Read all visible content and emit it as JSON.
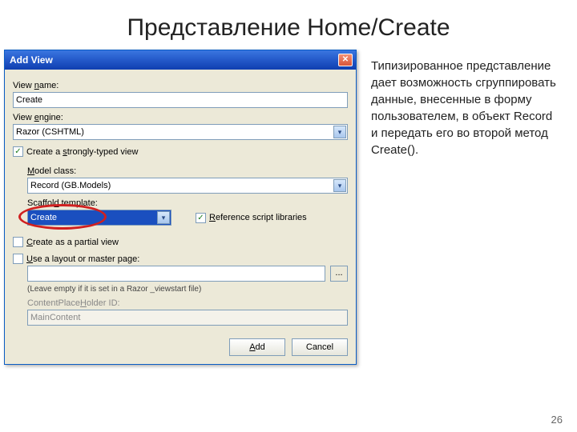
{
  "title": "Представление Home/Create",
  "dialog": {
    "title": "Add View",
    "labels": {
      "view_name": "View name:",
      "view_engine": "View engine:",
      "strongly_typed": "Create a strongly-typed view",
      "model_class": "Model class:",
      "scaffold_template": "Scaffold template:",
      "reference_libs": "Reference script libraries",
      "partial_view": "Create as a partial view",
      "use_layout": "Use a layout or master page:",
      "leave_empty": "(Leave empty if it is set in a Razor _viewstart file)",
      "contentplaceholder": "ContentPlaceHolder ID:"
    },
    "values": {
      "view_name": "Create",
      "view_engine": "Razor (CSHTML)",
      "model_class": "Record (GB.Models)",
      "scaffold_template": "Create",
      "layout_path": "",
      "contentplaceholder": "MainContent"
    },
    "checks": {
      "strongly_typed": true,
      "reference_libs": true,
      "partial_view": false,
      "use_layout": false
    },
    "buttons": {
      "browse": "...",
      "add": "Add",
      "cancel": "Cancel"
    }
  },
  "side_text": "Типизированное представление дает возможность сгруппировать данные, внесенные в форму пользователем, в объект Record и передать его во второй метод Create().",
  "page_number": "26"
}
